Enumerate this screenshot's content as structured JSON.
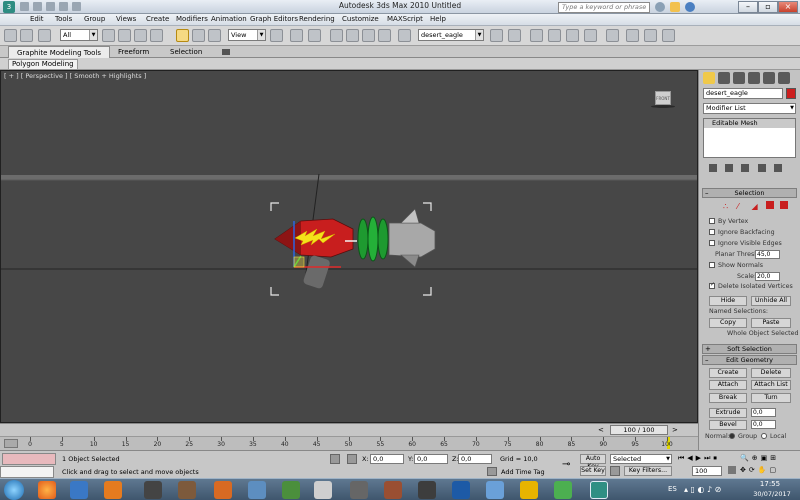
{
  "window": {
    "title": "Autodesk 3ds Max 2010        Untitled",
    "search_placeholder": "Type a keyword or phrase"
  },
  "menu": [
    "Edit",
    "Tools",
    "Group",
    "Views",
    "Create",
    "Modifiers",
    "Animation",
    "Graph Editors",
    "Rendering",
    "Customize",
    "MAXScript",
    "Help"
  ],
  "toolbar": {
    "selection_filter": "All",
    "ref_coord": "View",
    "named_selection": "desert_eagle"
  },
  "ribbon": {
    "tabs": [
      "Graphite Modeling Tools",
      "Freeform",
      "Selection"
    ],
    "panel_label": "Polygon Modeling"
  },
  "viewport": {
    "label": "[ + ] [ Perspective ] [ Smooth + Highlights ]",
    "viewcube_label": "FRONT"
  },
  "command_panel": {
    "object_name": "desert_eagle",
    "object_color": "#cc1f1f",
    "modifier_list": "Modifier List",
    "stack_item": "Editable Mesh",
    "selection_rollout": "Selection",
    "by_vertex": "By Vertex",
    "ignore_backfacing": "Ignore Backfacing",
    "ignore_visible_edges": "Ignore Visible Edges",
    "planar_thresh_label": "Planar Thresh:",
    "planar_thresh_value": "45,0",
    "show_normals": "Show Normals",
    "scale_label": "Scale:",
    "scale_value": "20,0",
    "delete_isolated": "Delete Isolated Vertices",
    "hide": "Hide",
    "unhide_all": "Unhide All",
    "named_selections": "Named Selections:",
    "copy": "Copy",
    "paste": "Paste",
    "whole_object": "Whole Object Selected",
    "soft_selection": "Soft Selection",
    "edit_geometry": "Edit Geometry",
    "create": "Create",
    "delete": "Delete",
    "attach": "Attach",
    "attach_list": "Attach List",
    "break": "Break",
    "turn": "Turn",
    "extrude": "Extrude",
    "extrude_value": "0,0",
    "bevel": "Bevel",
    "bevel_value": "0,0",
    "normal_label": "Normal:",
    "group": "Group",
    "local": "Local"
  },
  "timeline": {
    "frame_display": "100 / 100",
    "ticks": [
      "0",
      "5",
      "10",
      "15",
      "20",
      "25",
      "30",
      "35",
      "40",
      "45",
      "50",
      "55",
      "60",
      "65",
      "70",
      "75",
      "80",
      "85",
      "90",
      "95",
      "100"
    ]
  },
  "status": {
    "objects_selected": "1 Object Selected",
    "prompt": "Click and drag to select and move objects",
    "x_label": "X:",
    "x_value": "0,0",
    "y_label": "Y:",
    "y_value": "0,0",
    "z_label": "Z:",
    "z_value": "0,0",
    "grid": "Grid = 10,0",
    "add_time_tag": "Add Time Tag",
    "auto_key": "Auto Key",
    "selected": "Selected",
    "set_key": "Set Key",
    "key_filters": "Key Filters...",
    "frame": "100"
  },
  "taskbar": {
    "lang": "ES",
    "time": "17:55",
    "date": "30/07/2017"
  }
}
